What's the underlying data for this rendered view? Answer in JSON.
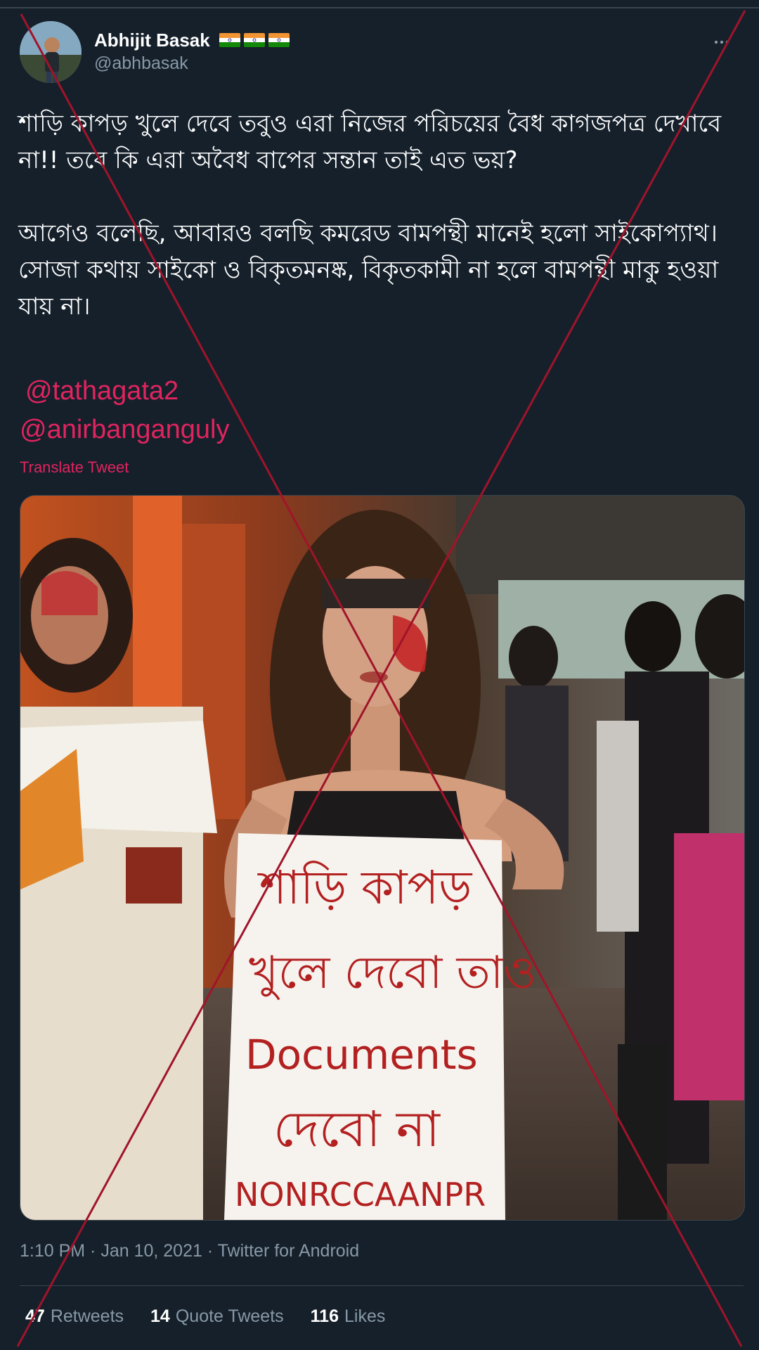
{
  "tweet": {
    "display_name": "Abhijit Basak",
    "handle": "@abhbasak",
    "flag_icons": [
      "india-flag-icon",
      "india-flag-icon",
      "india-flag-icon"
    ],
    "more_icon": "more-options-icon",
    "text": "শাড়ি কাপড় খুলে দেবে তবুও এরা নিজের পরিচয়ের বৈধ কাগজপত্র দেখাবে না!! তবে কি এরা অবৈধ বাপের সন্তান তাই এত ভয়?\n\nআগেও বলেছি, আবারও বলছি কমরেড বামপন্থী মানেই হলো সাইকোপ্যাথ। সোজা কথায় সাইকো ও বিকৃতমনষ্ক, বিকৃতকামী না হলে বামপন্থী মাকু হওয়া যায় না।",
    "mentions": [
      "@tathagata2",
      "@anirbanganguly"
    ],
    "translate_label": "Translate Tweet",
    "timestamp": "1:10 PM · Jan 10, 2021 · Twitter for Android",
    "stats": {
      "retweets_count": "47",
      "retweets_label": "Retweets",
      "quote_count": "14",
      "quote_label": "Quote Tweets",
      "likes_count": "116",
      "likes_label": "Likes"
    }
  },
  "media": {
    "sign_lines": [
      "শাড়ি কাপড়",
      "খুলে দেবো তাও",
      "Documents",
      "দেবো না",
      "NONRCCAANPR"
    ]
  },
  "colors": {
    "background": "#15202b",
    "secondary_text": "#8899a6",
    "mention": "#e0245e",
    "overlay_x": "#a0142a"
  }
}
